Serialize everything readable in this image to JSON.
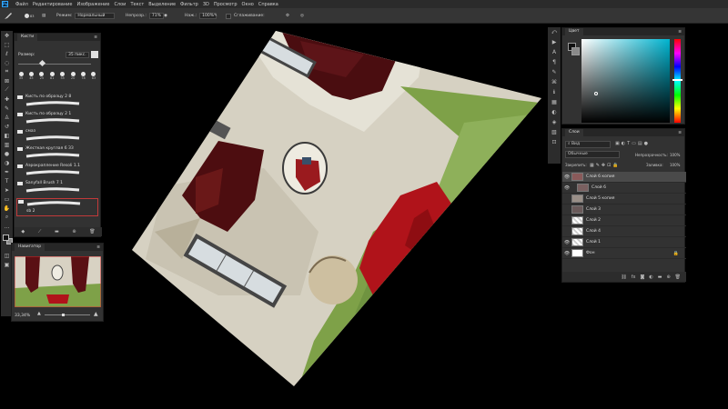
{
  "menu": [
    "Файл",
    "Редактирование",
    "Изображение",
    "Слои",
    "Текст",
    "Выделение",
    "Фильтр",
    "3D",
    "Просмотр",
    "Окно",
    "Справка"
  ],
  "options": {
    "size": "83",
    "mode_label": "Режим:",
    "mode_value": "Нормальный",
    "opacity_label": "Непрозр.:",
    "opacity_value": "71%",
    "pressure_label": "Наж.:",
    "pressure_value": "100%",
    "smoothing_label": "Сглаживание:"
  },
  "brushes": {
    "tab": "Кисти",
    "size_label": "Размер:",
    "size_value": "35 пикс.",
    "preset_numbers": [
      "35",
      "45",
      "25",
      "81",
      "55",
      "20",
      "78",
      "83"
    ],
    "items": [
      "Кисть по образцу 2 8",
      "Кисть по образцу 2 1",
      "смаз",
      "Жесткая круглая 6 ЗЗ",
      "Аэрокрапление Resoli 1.1",
      "Sanyfall Brush 7 1",
      "sb 2"
    ]
  },
  "navigator": {
    "title": "Навигатор",
    "zoom": "33,34%"
  },
  "color": {
    "title": "Цвет",
    "fg": "#111111",
    "bg": "#8a8a8a"
  },
  "layers": {
    "title": "Слои",
    "kind": "Вид",
    "blend": "Обычные",
    "opacity_label": "Непрозрачность:",
    "opacity_value": "100%",
    "lock_label": "Закрепить:",
    "fill_label": "Заливка:",
    "fill_value": "100%",
    "items": [
      {
        "name": "Слой 6 копия",
        "visible": true
      },
      {
        "name": "Слой 6",
        "visible": true
      },
      {
        "name": "Слой 5 копия",
        "visible": false
      },
      {
        "name": "Слой 3",
        "visible": false
      },
      {
        "name": "Слой 2",
        "visible": false
      },
      {
        "name": "Слой 4",
        "visible": false
      },
      {
        "name": "Слой 1",
        "visible": true
      },
      {
        "name": "Фон",
        "visible": true
      }
    ]
  }
}
